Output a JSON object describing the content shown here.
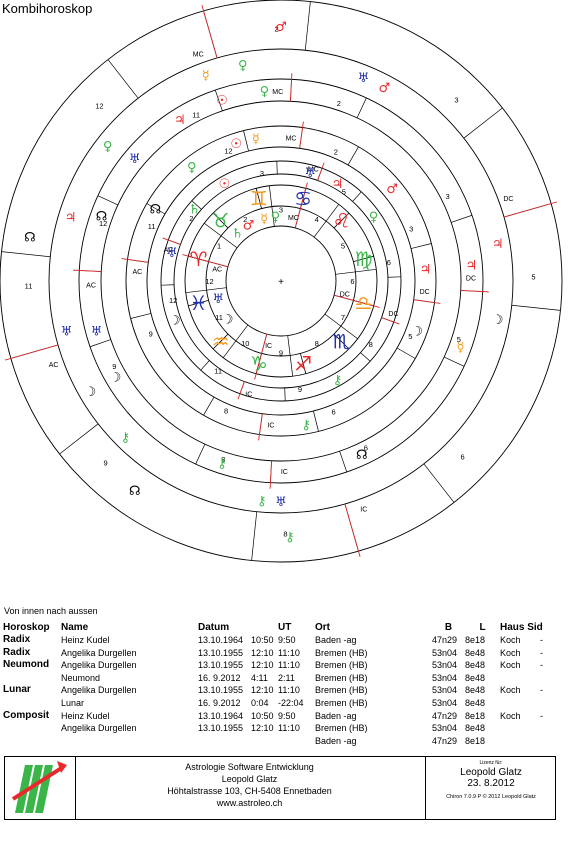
{
  "title": "Kombihoroskop",
  "chart_labels": {
    "center": "+",
    "ring1_houses": [
      "1",
      "2",
      "3",
      "4",
      "5",
      "6",
      "7",
      "8",
      "9",
      "10",
      "11",
      "12"
    ],
    "ring1_angles": {
      "asc": "AC",
      "mc": "MC",
      "dsc": "DC",
      "ic": "IC"
    },
    "ring2_houses": [
      "2",
      "3",
      "5",
      "6",
      "8",
      "9",
      "11",
      "12"
    ],
    "ring2_angles": {
      "asc": "AC",
      "mc": "MC",
      "dsc": "DC",
      "ic": "IC"
    },
    "ring3_houses": [
      "11",
      "12",
      "2",
      "3",
      "5",
      "6",
      "8",
      "9"
    ],
    "ring3_angles": {
      "asc": "AC",
      "mc": "MC",
      "dsc": "DC",
      "ic": "IC"
    },
    "ring4_houses": [
      "12",
      "11",
      "2",
      "3",
      "5",
      "6",
      "8",
      "9"
    ],
    "ring4_angles": {
      "asc": "AC",
      "mc": "MC",
      "dsc": "DC",
      "ic": "IC"
    },
    "ring5_houses": [
      "11",
      "12",
      "2",
      "3",
      "5",
      "6",
      "8",
      "9"
    ],
    "ring5_angles": {
      "asc": "AC",
      "mc": "MC",
      "dsc": "DC",
      "ic": "IC"
    }
  },
  "intro": "Von innen nach aussen",
  "table": {
    "headers": [
      "Horoskop",
      "Name",
      "Datum",
      "UT",
      "Ort",
      "B",
      "L",
      "Haus",
      "Sid"
    ],
    "rows": [
      {
        "type": "Radix",
        "name": "Heinz Kudel",
        "date": "13.10.1964",
        "time": "10:50",
        "ut": "9:50",
        "place": "Baden -ag",
        "b": "47n29",
        "l": "8e18",
        "haus": "Koch",
        "sid": "-"
      },
      {
        "type": "Radix",
        "name": "Angelika Durgellen",
        "date": "13.10.1955",
        "time": "12:10",
        "ut": "11:10",
        "place": "Bremen (HB)",
        "b": "53n04",
        "l": "8e48",
        "haus": "Koch",
        "sid": "-"
      },
      {
        "type": "Neumond",
        "name": "Angelika Durgellen",
        "date": "13.10.1955",
        "time": "12:10",
        "ut": "11:10",
        "place": "Bremen (HB)",
        "b": "53n04",
        "l": "8e48",
        "haus": "Koch",
        "sid": "-"
      },
      {
        "type": "",
        "name": "Neumond",
        "date": "16. 9.2012",
        "time": "4:11",
        "ut": "2:11",
        "place": "Bremen (HB)",
        "b": "53n04",
        "l": "8e48",
        "haus": "",
        "sid": ""
      },
      {
        "type": "Lunar",
        "name": "Angelika Durgellen",
        "date": "13.10.1955",
        "time": "12:10",
        "ut": "11:10",
        "place": "Bremen (HB)",
        "b": "53n04",
        "l": "8e48",
        "haus": "Koch",
        "sid": "-"
      },
      {
        "type": "",
        "name": "Lunar",
        "date": "16. 9.2012",
        "time": "0:04",
        "ut": "-22:04",
        "place": "Bremen (HB)",
        "b": "53n04",
        "l": "8e48",
        "haus": "",
        "sid": ""
      },
      {
        "type": "Composit",
        "name": "Heinz Kudel",
        "date": "13.10.1964",
        "time": "10:50",
        "ut": "9:50",
        "place": "Baden -ag",
        "b": "47n29",
        "l": "8e18",
        "haus": "Koch",
        "sid": "-"
      },
      {
        "type": "",
        "name": "Angelika Durgellen",
        "date": "13.10.1955",
        "time": "12:10",
        "ut": "11:10",
        "place": "Bremen (HB)",
        "b": "53n04",
        "l": "8e48",
        "haus": "",
        "sid": ""
      },
      {
        "type": "",
        "name": "",
        "date": "",
        "time": "",
        "ut": "",
        "place": "Baden -ag",
        "b": "47n29",
        "l": "8e18",
        "haus": "",
        "sid": ""
      }
    ]
  },
  "footer": {
    "company": "Astrologie Software Entwicklung",
    "person": "Leopold Glatz",
    "address": "Höhtalstrasse 103, CH-5408 Ennetbaden",
    "website": "www.astroleo.ch",
    "license_label": "Lizenz für:",
    "license_name": "Leopold Glatz",
    "license_date": "23. 8.2012",
    "version": "Chiron 7.0.9 P © 2012 Leopold Glatz"
  },
  "colors": {
    "fire": "#e8282a",
    "earth": "#3bb54a",
    "air": "#f29a1e",
    "water": "#1f2fa8",
    "lines": "#000000",
    "angles": "#d42a2a"
  },
  "planets": [
    {
      "name": "sun",
      "glyph": "☉",
      "color": "#e8282a"
    },
    {
      "name": "moon",
      "glyph": "☽",
      "color": "#000000"
    },
    {
      "name": "mercury",
      "glyph": "☿",
      "color": "#f29a1e"
    },
    {
      "name": "venus",
      "glyph": "♀",
      "color": "#3bb54a"
    },
    {
      "name": "mars",
      "glyph": "♂",
      "color": "#e8282a"
    },
    {
      "name": "jupiter",
      "glyph": "♃",
      "color": "#e8282a"
    },
    {
      "name": "saturn",
      "glyph": "♄",
      "color": "#3bb54a"
    },
    {
      "name": "uranus",
      "glyph": "♅",
      "color": "#1f2fa8"
    },
    {
      "name": "neptune",
      "glyph": "♆",
      "color": "#1f2fa8"
    },
    {
      "name": "pluto",
      "glyph": "⚷",
      "color": "#3bb54a"
    },
    {
      "name": "node",
      "glyph": "☊",
      "color": "#000000"
    }
  ]
}
